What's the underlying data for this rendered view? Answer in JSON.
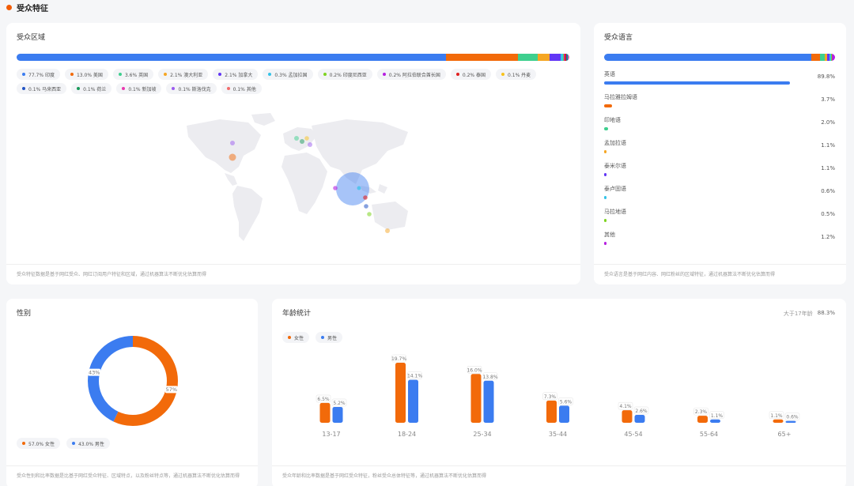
{
  "section": {
    "title": "受众特征",
    "dot_color": "#f25c05"
  },
  "region": {
    "title": "受众区域",
    "footer": "受众特征数据是基于网红受众、网红订阅用户特征和区域，通过机器算法不断优化估算而得",
    "items": [
      {
        "label": "77.7% 印度",
        "pct": 77.7,
        "color": "#3b7cf0"
      },
      {
        "label": "13.0% 美国",
        "pct": 13.0,
        "color": "#f26a0a"
      },
      {
        "label": "3.6% 英国",
        "pct": 3.6,
        "color": "#3ecf8e"
      },
      {
        "label": "2.1% 澳大利亚",
        "pct": 2.1,
        "color": "#f5a623"
      },
      {
        "label": "2.1% 加拿大",
        "pct": 2.1,
        "color": "#6236f5"
      },
      {
        "label": "0.3% 孟加拉国",
        "pct": 0.3,
        "color": "#33c3e8"
      },
      {
        "label": "0.2% 印度尼西亚",
        "pct": 0.2,
        "color": "#7ed321"
      },
      {
        "label": "0.2% 阿拉伯联合酋长国",
        "pct": 0.2,
        "color": "#b620e0"
      },
      {
        "label": "0.2% 泰国",
        "pct": 0.2,
        "color": "#e02020"
      },
      {
        "label": "0.1% 丹麦",
        "pct": 0.1,
        "color": "#f8c21c"
      },
      {
        "label": "0.1% 马来西亚",
        "pct": 0.1,
        "color": "#2253c4"
      },
      {
        "label": "0.1% 荷兰",
        "pct": 0.1,
        "color": "#1a9a5a"
      },
      {
        "label": "0.1% 新加坡",
        "pct": 0.1,
        "color": "#e838b0"
      },
      {
        "label": "0.1% 斯洛伐克",
        "pct": 0.1,
        "color": "#9b5cf0"
      },
      {
        "label": "0.1% 其他",
        "pct": 0.1,
        "color": "#f26b6b"
      }
    ]
  },
  "language": {
    "title": "受众语言",
    "footer": "受众语言是基于网红内容、网红粉丝的区域特征，通过机器算法不断优化估算而得",
    "items": [
      {
        "name": "英语",
        "pct_label": "89.8%",
        "pct": 89.8,
        "color": "#3b7cf0"
      },
      {
        "name": "马拉雅拉姆语",
        "pct_label": "3.7%",
        "pct": 3.7,
        "color": "#f26a0a"
      },
      {
        "name": "印地语",
        "pct_label": "2.0%",
        "pct": 2.0,
        "color": "#3ecf8e"
      },
      {
        "name": "孟加拉语",
        "pct_label": "1.1%",
        "pct": 1.1,
        "color": "#f5a623"
      },
      {
        "name": "泰米尔语",
        "pct_label": "1.1%",
        "pct": 1.1,
        "color": "#6236f5"
      },
      {
        "name": "泰卢固语",
        "pct_label": "0.6%",
        "pct": 0.6,
        "color": "#33c3e8"
      },
      {
        "name": "马拉地语",
        "pct_label": "0.5%",
        "pct": 0.5,
        "color": "#7ed321"
      },
      {
        "name": "其他",
        "pct_label": "1.2%",
        "pct": 1.2,
        "color": "#b620e0"
      }
    ]
  },
  "gender": {
    "title": "性别",
    "footer": "受众性别和比率数据是比基于网红受众特征、区域特点，以及粉丝特点等，通过机器算法不断优化估算而得",
    "female": {
      "legend": "57.0% 女性",
      "pct": 57.0,
      "label": "57%",
      "color": "#f26a0a"
    },
    "male": {
      "legend": "43.0% 男性",
      "pct": 43.0,
      "label": "43%",
      "color": "#3b7cf0"
    }
  },
  "age": {
    "title": "年龄统计",
    "summary_label": "大于17年龄",
    "summary_value": "88.3%",
    "footer": "受众年龄和比率数据是基于网红受众特征，粉丝受众总体特征等，通过机器算法不断优化估算而得",
    "legend_female": "女性",
    "legend_male": "男性",
    "female_color": "#f26a0a",
    "male_color": "#3b7cf0"
  },
  "chart_data": {
    "type": "bar",
    "categories": [
      "13-17",
      "18-24",
      "25-34",
      "35-44",
      "45-54",
      "55-64",
      "65+"
    ],
    "series": [
      {
        "name": "女性",
        "values": [
          6.5,
          19.7,
          16.0,
          7.3,
          4.1,
          2.3,
          1.1
        ],
        "labels": [
          "6.5%",
          "19.7%",
          "16.0%",
          "7.3%",
          "4.1%",
          "2.3%",
          "1.1%"
        ]
      },
      {
        "name": "男性",
        "values": [
          5.2,
          14.1,
          13.8,
          5.6,
          2.6,
          1.1,
          0.6
        ],
        "labels": [
          "5.2%",
          "14.1%",
          "13.8%",
          "5.6%",
          "2.6%",
          "1.1%",
          "0.6%"
        ]
      }
    ],
    "title": "年龄统计",
    "legend": "top-left",
    "grid": false
  }
}
